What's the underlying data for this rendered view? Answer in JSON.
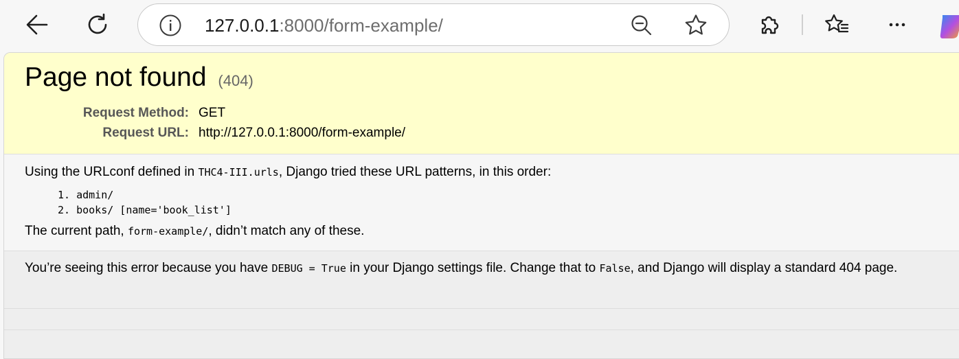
{
  "browser": {
    "url_host": "127.0.0.1",
    "url_rest": ":8000/form-example/",
    "icons": [
      "back-arrow-icon",
      "refresh-icon",
      "site-info-icon",
      "zoom-out-icon",
      "favorite-star-icon",
      "extensions-icon",
      "favorites-list-icon",
      "more-menu-icon",
      "copilot-icon"
    ]
  },
  "error": {
    "title": "Page not found",
    "status_code": "(404)",
    "request_method_label": "Request Method:",
    "request_method": "GET",
    "request_url_label": "Request URL:",
    "request_url": "http://127.0.0.1:8000/form-example/"
  },
  "info": {
    "intro_before": "Using the URLconf defined in ",
    "urlconf": "THC4-III.urls",
    "intro_after": ", Django tried these URL patterns, in this order:",
    "patterns": [
      "1. admin/",
      "2. books/ [name='book_list']"
    ],
    "current_before": "The current path, ",
    "current_path": "form-example/",
    "current_after": ", didn’t match any of these."
  },
  "explanation": {
    "part1": "You’re seeing this error because you have ",
    "debug_code": "DEBUG = True",
    "part2": " in your Django settings file. Change that to ",
    "false_code": "False",
    "part3": ", and Django will display a standard 404 page."
  },
  "colors": {
    "summary_bg": "#ffffcc",
    "info_bg": "#f6f6f6",
    "explanation_bg": "#eeeeee",
    "toolbar_bg": "#f7f7f7"
  }
}
